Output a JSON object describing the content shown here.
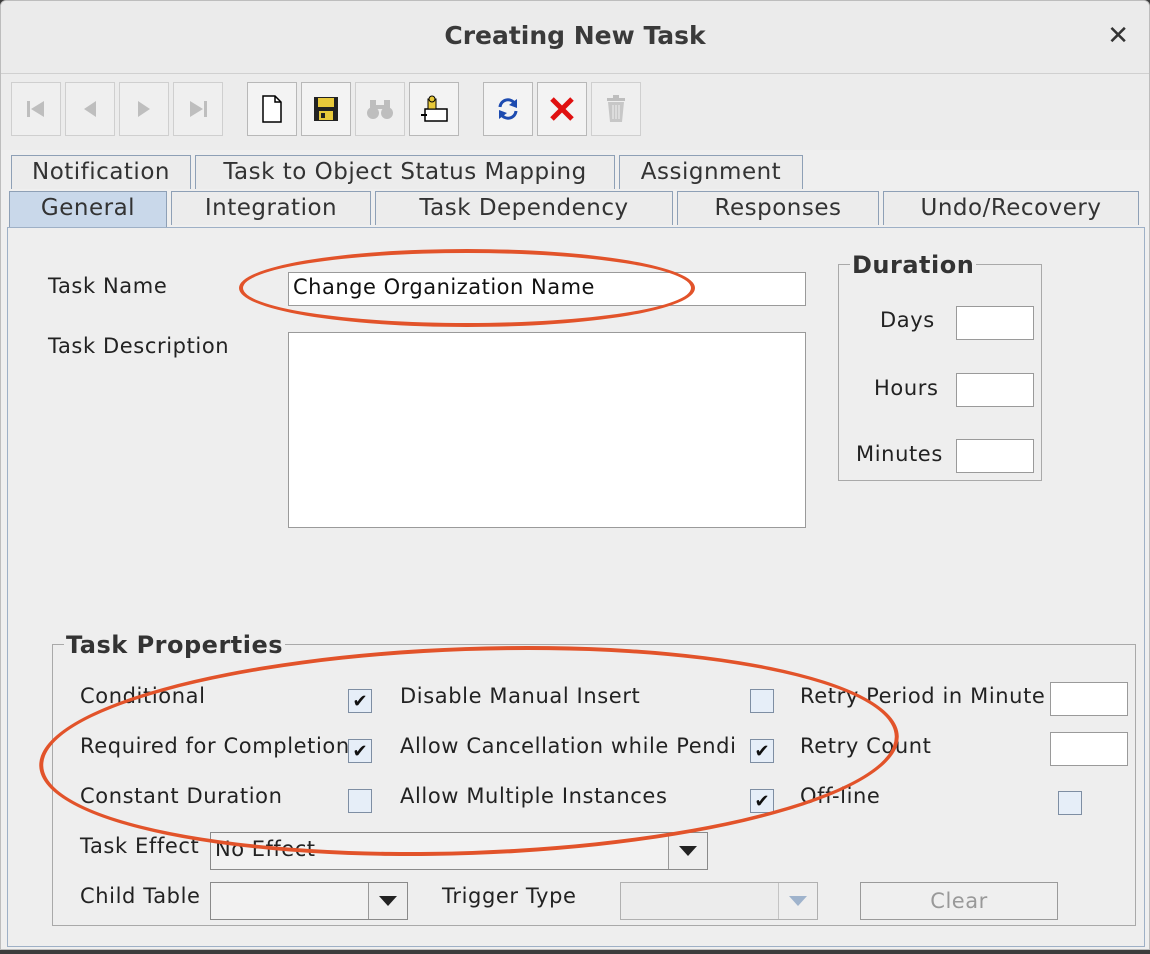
{
  "window": {
    "title": "Creating New Task",
    "close_glyph": "✕"
  },
  "toolbar": {
    "buttons": [
      {
        "name": "first-record",
        "icon": "first-icon",
        "enabled": false
      },
      {
        "name": "previous-record",
        "icon": "previous-icon",
        "enabled": false
      },
      {
        "name": "next-record",
        "icon": "next-icon",
        "enabled": false
      },
      {
        "name": "last-record",
        "icon": "last-icon",
        "enabled": false
      },
      {
        "name": "new",
        "icon": "new-document-icon",
        "enabled": true
      },
      {
        "name": "save",
        "icon": "save-icon",
        "enabled": true
      },
      {
        "name": "find",
        "icon": "binoculars-icon",
        "enabled": false
      },
      {
        "name": "assign",
        "icon": "assign-icon",
        "enabled": true
      },
      {
        "name": "refresh",
        "icon": "refresh-icon",
        "enabled": true
      },
      {
        "name": "delete",
        "icon": "delete-x-icon",
        "enabled": true
      },
      {
        "name": "trash",
        "icon": "trash-icon",
        "enabled": false
      }
    ]
  },
  "tabs": {
    "row1": [
      "Notification",
      "Task to Object Status Mapping",
      "Assignment"
    ],
    "row2": [
      "General",
      "Integration",
      "Task Dependency",
      "Responses",
      "Undo/Recovery"
    ],
    "selected": "General"
  },
  "general": {
    "task_name_label": "Task Name",
    "task_name_value": "Change Organization Name",
    "task_description_label": "Task Description",
    "task_description_value": ""
  },
  "duration": {
    "title": "Duration",
    "days_label": "Days",
    "hours_label": "Hours",
    "minutes_label": "Minutes"
  },
  "properties": {
    "title": "Task Properties",
    "conditional": {
      "label": "Conditional",
      "checked": true
    },
    "required_for_completion": {
      "label": "Required for Completion",
      "checked": true
    },
    "constant_duration": {
      "label": "Constant Duration",
      "checked": false
    },
    "disable_manual_insert": {
      "label": "Disable Manual Insert",
      "checked": false
    },
    "allow_cancellation": {
      "label": "Allow Cancellation while Pendi",
      "checked": true
    },
    "allow_multiple_instances": {
      "label": "Allow Multiple Instances",
      "checked": true
    },
    "retry_period_label": "Retry Period in Minute",
    "retry_count_label": "Retry Count",
    "offline": {
      "label": "Off-line",
      "checked": false
    },
    "task_effect_label": "Task Effect",
    "task_effect_value": "No Effect",
    "child_table_label": "Child Table",
    "child_table_value": "",
    "trigger_type_label": "Trigger Type",
    "trigger_type_value": "",
    "clear_label": "Clear"
  },
  "colors": {
    "annotation": "#e2532a",
    "selected_tab": "#c9d8ea"
  }
}
